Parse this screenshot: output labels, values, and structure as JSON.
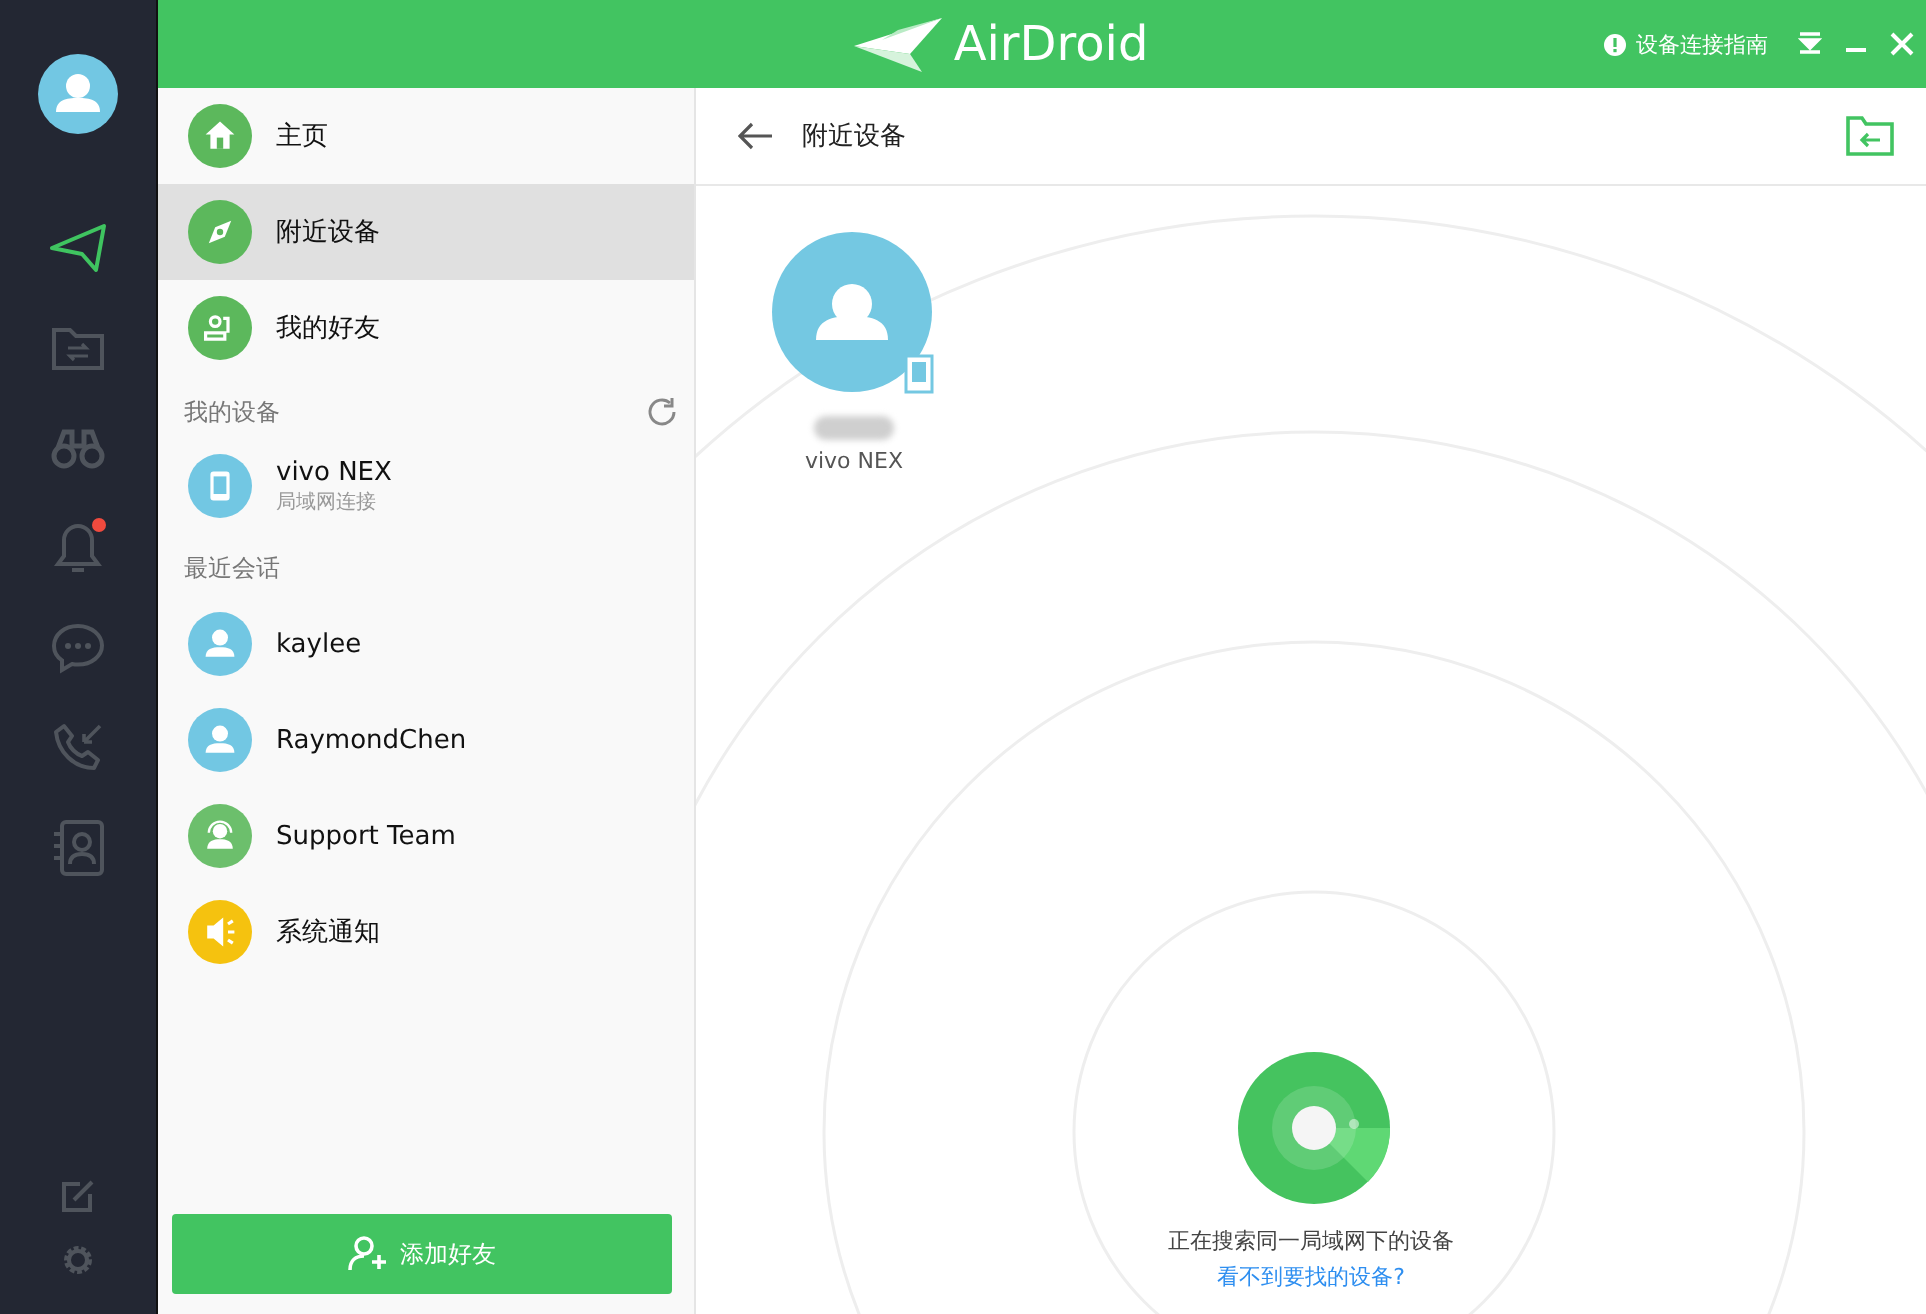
{
  "app": {
    "logo": "AirDroid",
    "guide": "设备连接指南"
  },
  "rail": [
    {
      "kind": "send",
      "selected": true,
      "badge": false
    },
    {
      "kind": "files",
      "selected": false,
      "badge": false
    },
    {
      "kind": "binoculars",
      "selected": false,
      "badge": false
    },
    {
      "kind": "bell",
      "selected": false,
      "badge": true
    },
    {
      "kind": "chat",
      "selected": false,
      "badge": false
    },
    {
      "kind": "calls",
      "selected": false,
      "badge": false
    },
    {
      "kind": "contacts",
      "selected": false,
      "badge": false
    }
  ],
  "rail_bottom": [
    {
      "kind": "edit"
    },
    {
      "kind": "settings"
    }
  ],
  "nav": [
    {
      "kind": "home",
      "label": "主页",
      "selected": false
    },
    {
      "kind": "compass",
      "label": "附近设备",
      "selected": true
    },
    {
      "kind": "friends",
      "label": "我的好友",
      "selected": false
    }
  ],
  "my_devices": {
    "heading": "我的设备",
    "items": [
      {
        "name": "vivo NEX",
        "status": "局域网连接"
      }
    ]
  },
  "recent": {
    "heading": "最近会话",
    "items": [
      {
        "kind": "user",
        "name": "kaylee"
      },
      {
        "kind": "user",
        "name": "RaymondChen"
      },
      {
        "kind": "support",
        "name": "Support Team"
      },
      {
        "kind": "notice",
        "name": "系统通知"
      }
    ]
  },
  "add_friend": "添加好友",
  "main": {
    "title": "附近设备",
    "devices": [
      {
        "name": "vivo NEX"
      }
    ],
    "searching": "正在搜索同一局域网下的设备",
    "help_link": "看不到要找的设备?"
  }
}
